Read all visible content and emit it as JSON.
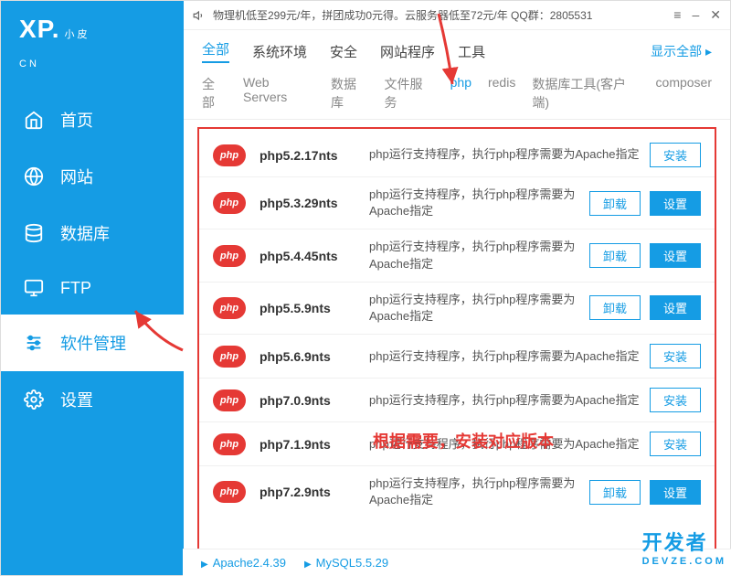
{
  "logo": {
    "main": "XP.",
    "sub1": "小皮",
    "sub2": "CN"
  },
  "nav": [
    {
      "label": "首页",
      "icon": "home"
    },
    {
      "label": "网站",
      "icon": "globe"
    },
    {
      "label": "数据库",
      "icon": "database"
    },
    {
      "label": "FTP",
      "icon": "monitor"
    },
    {
      "label": "软件管理",
      "icon": "sliders"
    },
    {
      "label": "设置",
      "icon": "gear"
    }
  ],
  "nav_active": 4,
  "announcement": "物理机低至299元/年，拼团成功0元得。云服务器低至72元/年   QQ群：2805531",
  "tabs1": [
    "全部",
    "系统环境",
    "安全",
    "网站程序",
    "工具"
  ],
  "tabs1_active": 0,
  "show_all": "显示全部",
  "tabs2": [
    "全部",
    "Web Servers",
    "数据库",
    "文件服务",
    "php",
    "redis",
    "数据库工具(客户端)",
    "composer"
  ],
  "tabs2_active": 4,
  "rows": [
    {
      "name": "php5.2.17nts",
      "desc": "php运行支持程序，执行php程序需要为Apache指定",
      "actions": [
        "install"
      ]
    },
    {
      "name": "php5.3.29nts",
      "desc": "php运行支持程序，执行php程序需要为Apache指定",
      "actions": [
        "uninstall",
        "config"
      ]
    },
    {
      "name": "php5.4.45nts",
      "desc": "php运行支持程序，执行php程序需要为Apache指定",
      "actions": [
        "uninstall",
        "config"
      ]
    },
    {
      "name": "php5.5.9nts",
      "desc": "php运行支持程序，执行php程序需要为Apache指定",
      "actions": [
        "uninstall",
        "config"
      ]
    },
    {
      "name": "php5.6.9nts",
      "desc": "php运行支持程序，执行php程序需要为Apache指定",
      "actions": [
        "install"
      ]
    },
    {
      "name": "php7.0.9nts",
      "desc": "php运行支持程序，执行php程序需要为Apache指定",
      "actions": [
        "install"
      ]
    },
    {
      "name": "php7.1.9nts",
      "desc": "php运行支持程序，执行php程序需要为Apache指定",
      "actions": [
        "install"
      ]
    },
    {
      "name": "php7.2.9nts",
      "desc": "php运行支持程序，执行php程序需要为Apache指定",
      "actions": [
        "uninstall",
        "config"
      ]
    }
  ],
  "btn_labels": {
    "install": "安装",
    "uninstall": "卸载",
    "config": "设置"
  },
  "annotation_text": "根据需要，安装对应版本",
  "services": [
    "Apache2.4.39",
    "MySQL5.5.29"
  ],
  "watermark": {
    "line1": "开发者",
    "line2": "DEVZE.COM"
  },
  "php_badge": "php"
}
